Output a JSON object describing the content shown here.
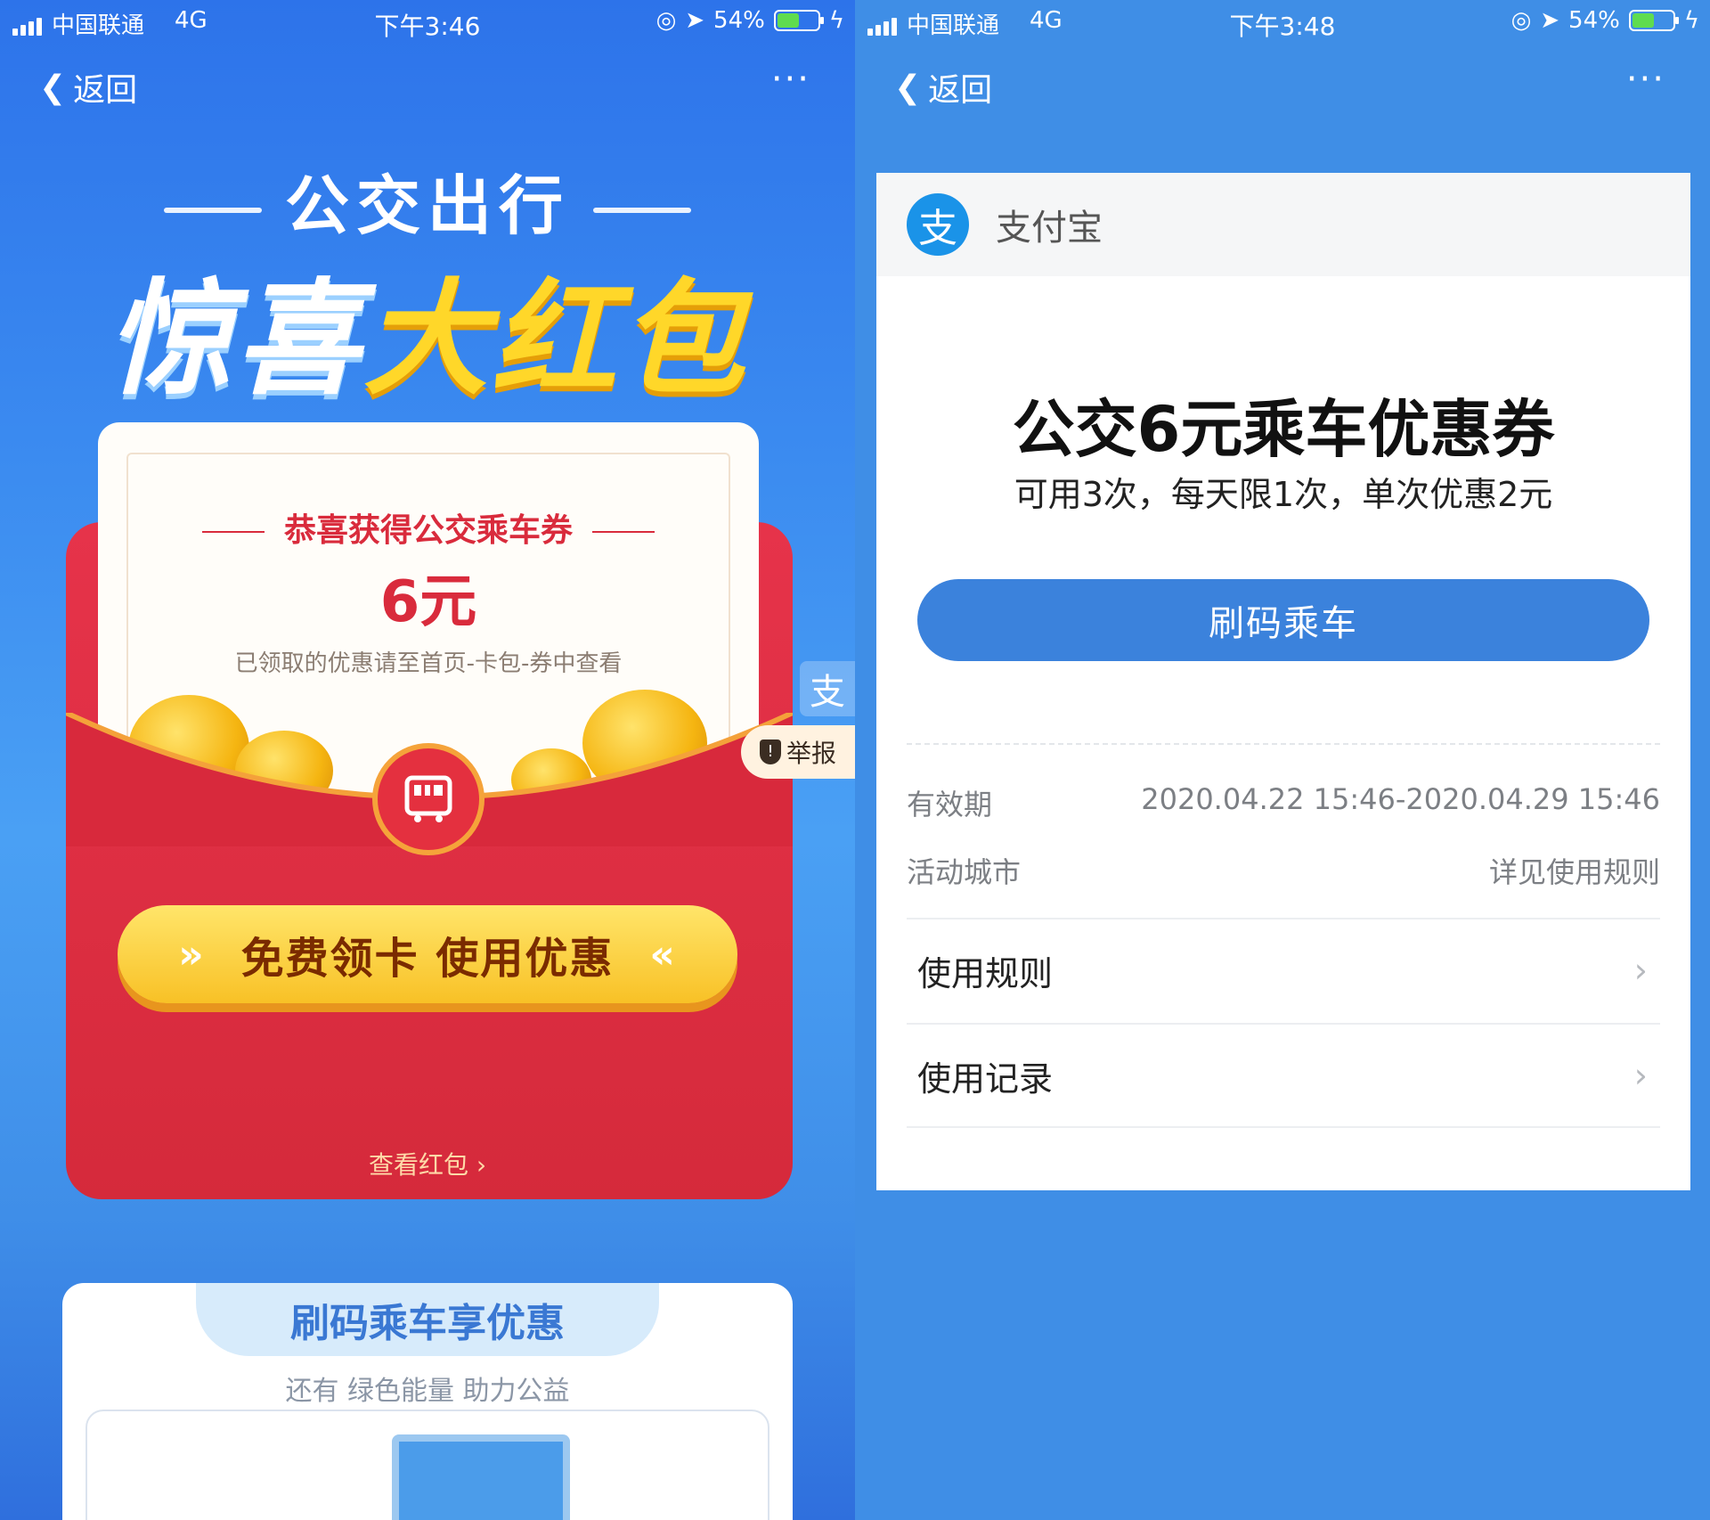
{
  "left": {
    "status": {
      "carrier": "中国联通",
      "network": "4G",
      "time": "下午3:46",
      "battery": "54%"
    },
    "nav": {
      "back": "返回",
      "more": "···"
    },
    "hero": {
      "line1": "公交出行",
      "line2_white": "惊喜",
      "line2_yellow": "大红包"
    },
    "coupon": {
      "title": "恭喜获得公交乘车券",
      "amount": "6元",
      "hint": "已领取的优惠请至首页-卡包-券中查看"
    },
    "cta": {
      "label": "免费领卡 使用优惠",
      "arrow_left": "»",
      "arrow_right": "«"
    },
    "view_packet": "查看红包 ›",
    "side_badge": "支",
    "report": {
      "label": "举报",
      "icon": "!"
    },
    "bottom": {
      "title": "刷码乘车享优惠",
      "subtitle": "还有 绿色能量 助力公益"
    }
  },
  "right": {
    "status": {
      "carrier": "中国联通",
      "network": "4G",
      "time": "下午3:48",
      "battery": "54%"
    },
    "nav": {
      "back": "返回",
      "more": "···"
    },
    "merchant": {
      "logo": "支",
      "name": "支付宝"
    },
    "coupon_title": "公交6元乘车优惠券",
    "coupon_sub": "可用3次，每天限1次，单次优惠2元",
    "ride_button": "刷码乘车",
    "validity": {
      "label": "有效期",
      "value": "2020.04.22 15:46-2020.04.29 15:46"
    },
    "city": {
      "label": "活动城市",
      "value": "详见使用规则"
    },
    "menu": [
      {
        "label": "使用规则",
        "chevron": "›"
      },
      {
        "label": "使用记录",
        "chevron": "›"
      }
    ]
  },
  "colors": {
    "brand_blue": "#3b82dc",
    "red": "#d92b3c",
    "gold": "#ffd729"
  }
}
